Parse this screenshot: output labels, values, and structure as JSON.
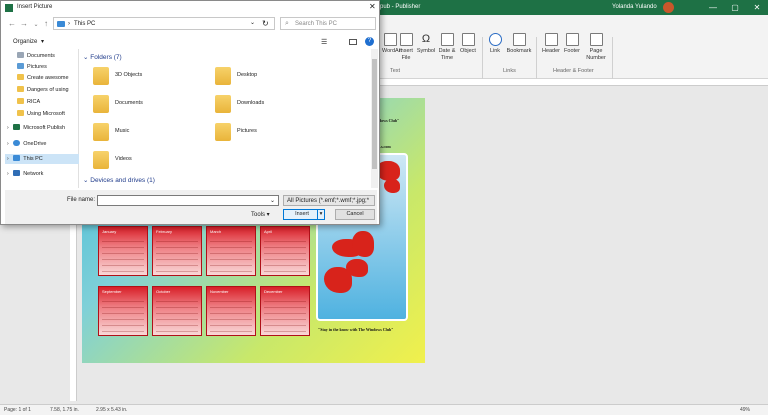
{
  "app": {
    "title": "pub - Publisher",
    "user": "Yolanda Yulando",
    "window_controls": [
      "—",
      "▢",
      "✕"
    ]
  },
  "ribbon": {
    "buttons": [
      {
        "label": "WordArt",
        "icon": "wordart-icon"
      },
      {
        "label": "Insert File",
        "icon": "insert-file-icon"
      },
      {
        "label": "Symbol",
        "icon": "omega-icon"
      },
      {
        "label": "Date & Time",
        "icon": "calendar-icon"
      },
      {
        "label": "Object",
        "icon": "object-icon"
      },
      {
        "label": "Link",
        "icon": "link-icon"
      },
      {
        "label": "Bookmark",
        "icon": "bookmark-icon"
      },
      {
        "label": "Header",
        "icon": "header-icon"
      },
      {
        "label": "Footer",
        "icon": "footer-icon"
      },
      {
        "label": "Page Number",
        "icon": "page-number-icon"
      }
    ],
    "groups": [
      "Text",
      "Links",
      "Header & Footer"
    ]
  },
  "dialog": {
    "title": "Insert Picture",
    "path": "This PC",
    "search_placeholder": "Search This PC",
    "organize": "Organize",
    "nav_items": [
      {
        "label": "Documents",
        "pinned": true
      },
      {
        "label": "Pictures",
        "pinned": true
      },
      {
        "label": "Create awesome"
      },
      {
        "label": "Dangers of using"
      },
      {
        "label": "RICA"
      },
      {
        "label": "Using Microsoft"
      },
      {
        "label": "Microsoft Publish"
      },
      {
        "label": "OneDrive"
      },
      {
        "label": "This PC",
        "selected": true
      },
      {
        "label": "Network"
      }
    ],
    "folders_header": "Folders (7)",
    "folders": [
      "3D Objects",
      "Desktop",
      "Documents",
      "Downloads",
      "Music",
      "Pictures",
      "Videos"
    ],
    "devices_header": "Devices and drives (1)",
    "file_name_label": "File name:",
    "file_type": "All Pictures (*.emf;*.wmf;*.jpg;*",
    "tools": "Tools",
    "insert": "Insert",
    "cancel": "Cancel"
  },
  "document": {
    "header_partial": "...dows Club\"",
    "url_partial": "...s.com",
    "tagline": "\"Stay in the know with The Windows Club\"",
    "months": [
      "January",
      "February",
      "March",
      "April",
      "September",
      "October",
      "November",
      "December"
    ]
  },
  "status": {
    "page": "Page: 1 of 1",
    "position": "7.58, 1.75 in.",
    "size": "2.95 x 5.43 in.",
    "zoom": "49%"
  },
  "colors": {
    "publisher_green": "#1e7145",
    "calendar_red": "#d81f28",
    "accent_blue": "#0078d7"
  }
}
